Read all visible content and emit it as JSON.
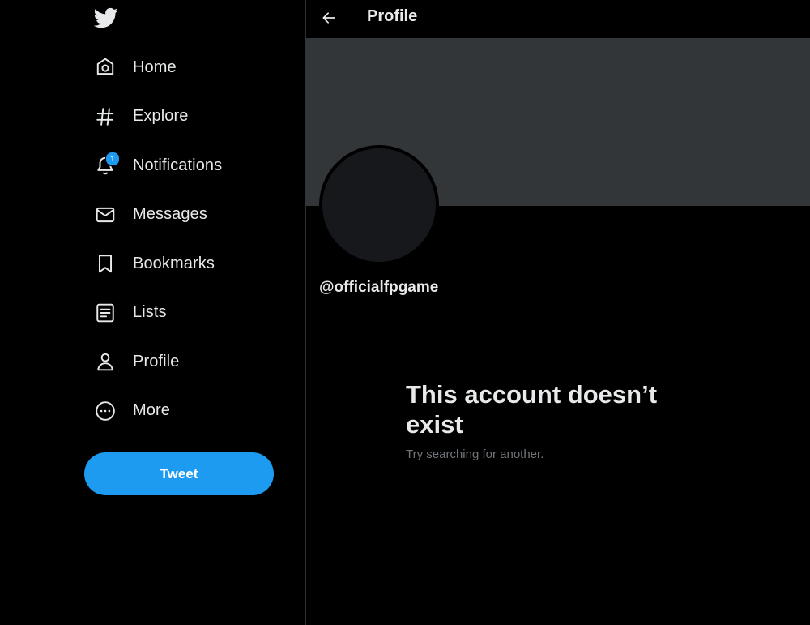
{
  "app": {
    "logo_icon": "twitter-bird-icon",
    "accent_color": "#1d9bf0"
  },
  "sidebar": {
    "items": [
      {
        "label": "Home",
        "icon": "home-icon"
      },
      {
        "label": "Explore",
        "icon": "hashtag-icon"
      },
      {
        "label": "Notifications",
        "icon": "bell-icon",
        "badge": "1"
      },
      {
        "label": "Messages",
        "icon": "envelope-icon"
      },
      {
        "label": "Bookmarks",
        "icon": "bookmark-icon"
      },
      {
        "label": "Lists",
        "icon": "list-icon"
      },
      {
        "label": "Profile",
        "icon": "person-icon"
      },
      {
        "label": "More",
        "icon": "more-circle-icon"
      }
    ],
    "tweet_label": "Tweet"
  },
  "header": {
    "back_icon": "back-arrow-icon",
    "title": "Profile"
  },
  "profile": {
    "handle": "@officialfpgame",
    "empty_title": "This account doesn’t exist",
    "empty_subtitle": "Try searching for another."
  }
}
